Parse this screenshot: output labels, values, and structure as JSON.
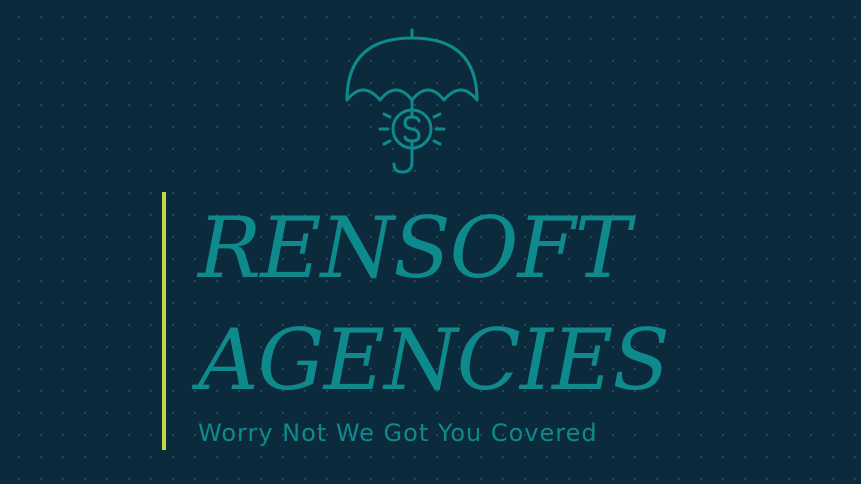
{
  "brand": {
    "line1": "RENSOFT",
    "line2": "AGENCIES",
    "tagline": "Worry Not We Got You Covered"
  },
  "logo": {
    "icon": "umbrella-dollar-icon"
  },
  "colors": {
    "background": "#0b2a3c",
    "text": "#0f8a8c",
    "accent": "#c3d64d"
  }
}
